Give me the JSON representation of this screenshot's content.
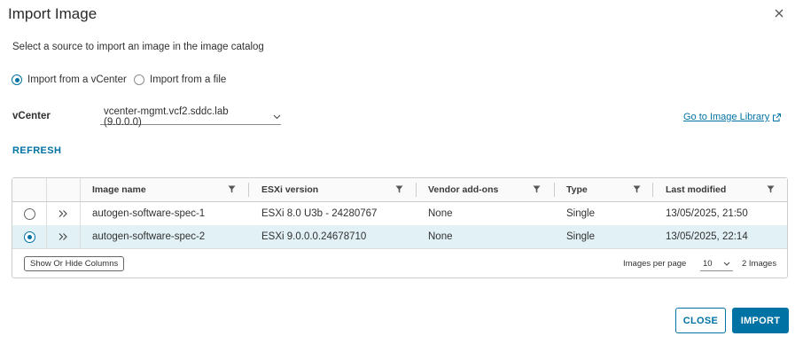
{
  "dialog": {
    "title": "Import Image",
    "subtitle": "Select a source to import an image in the image catalog"
  },
  "source": {
    "options": [
      {
        "label": "Import from a vCenter",
        "selected": true
      },
      {
        "label": "Import from a file",
        "selected": false
      }
    ]
  },
  "vcenter": {
    "label": "vCenter",
    "value": "vcenter-mgmt.vcf2.sddc.lab (9.0.0.0)"
  },
  "links": {
    "image_library": "Go to Image Library"
  },
  "actions": {
    "refresh": "REFRESH",
    "close": "CLOSE",
    "import": "IMPORT"
  },
  "table": {
    "columns": [
      "Image name",
      "ESXi version",
      "Vendor add-ons",
      "Type",
      "Last modified"
    ],
    "rows": [
      {
        "selected": false,
        "name": "autogen-software-spec-1",
        "esxi": "ESXi 8.0 U3b - 24280767",
        "addons": "None",
        "type": "Single",
        "modified": "13/05/2025, 21:50"
      },
      {
        "selected": true,
        "name": "autogen-software-spec-2",
        "esxi": "ESXi 9.0.0.0.24678710",
        "addons": "None",
        "type": "Single",
        "modified": "13/05/2025, 22:14"
      }
    ],
    "footer": {
      "show_hide": "Show Or Hide Columns",
      "per_page_label": "Images per page",
      "per_page_value": "10",
      "count": "2 Images"
    }
  },
  "colors": {
    "accent": "#0072a3",
    "selected_row": "#e1f1f6"
  },
  "icons": [
    "close-icon",
    "chevron-down-icon",
    "external-link-icon",
    "filter-icon",
    "expand-chevron-icon"
  ]
}
